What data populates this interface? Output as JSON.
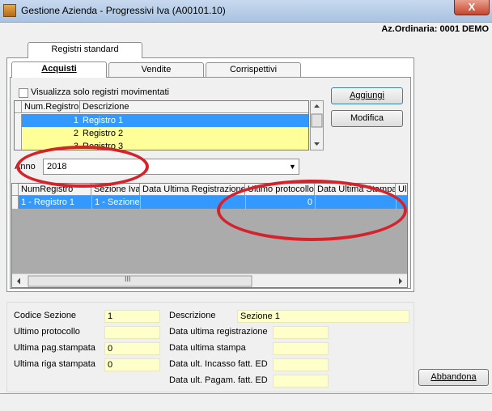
{
  "window": {
    "title": "Gestione Azienda - Progressivi Iva (A00101.10)",
    "close_glyph": "X",
    "company": "Az.Ordinaria: 0001 DEMO"
  },
  "tabs": {
    "outer": "Registri standard",
    "inner": [
      "Acquisti",
      "Vendite",
      "Corrispettivi"
    ]
  },
  "filter": {
    "checkbox_label": "Visualizza solo registri movimentati",
    "checked": false
  },
  "buttons": {
    "aggiungi": "Aggiungi",
    "modifica": "Modifica",
    "abbandona": "Abbandona"
  },
  "registri": {
    "columns": [
      "Num.Registro",
      "Descrizione"
    ],
    "rows": [
      [
        "1",
        "Registro 1"
      ],
      [
        "2",
        "Registro 2"
      ],
      [
        "3",
        "Registro 3"
      ]
    ]
  },
  "anno": {
    "label": "Anno",
    "value": "2018"
  },
  "progressivi": {
    "columns": [
      "NumRegistro",
      "Sezione Iva",
      "Data Ultima Registrazione",
      "Ultimo protocollo",
      "Data Ultima Stampa",
      "Ul"
    ],
    "rows": [
      [
        "1 - Registro 1",
        "1 - Sezione",
        "",
        "0",
        "",
        ""
      ]
    ],
    "scroll_grip": "III"
  },
  "details": {
    "codice_sezione": {
      "label": "Codice Sezione",
      "value": "1"
    },
    "ultimo_protocollo": {
      "label": "Ultimo protocollo",
      "value": ""
    },
    "ultima_pag_stampata": {
      "label": "Ultima pag.stampata",
      "value": "0"
    },
    "ultima_riga_stampata": {
      "label": "Ultima riga stampata",
      "value": "0"
    },
    "descrizione": {
      "label": "Descrizione",
      "value": "Sezione 1"
    },
    "data_ultima_registrazione": {
      "label": "Data ultima registrazione",
      "value": ""
    },
    "data_ultima_stampa": {
      "label": "Data ultima stampa",
      "value": ""
    },
    "data_ult_incasso": {
      "label": "Data ult. Incasso fatt. ED",
      "value": ""
    },
    "data_ult_pagam": {
      "label": "Data ult. Pagam. fatt. ED",
      "value": ""
    }
  },
  "colors": {
    "selection": "#3399ff",
    "highlight_row": "#ffff99",
    "annotation_ellipse": "#d4232b",
    "field_bg": "#ffffcc"
  },
  "icons": [
    "app-icon",
    "close-icon",
    "chevron-down-icon",
    "arrow-up-icon",
    "arrow-down-icon",
    "arrow-left-icon",
    "arrow-right-icon"
  ]
}
